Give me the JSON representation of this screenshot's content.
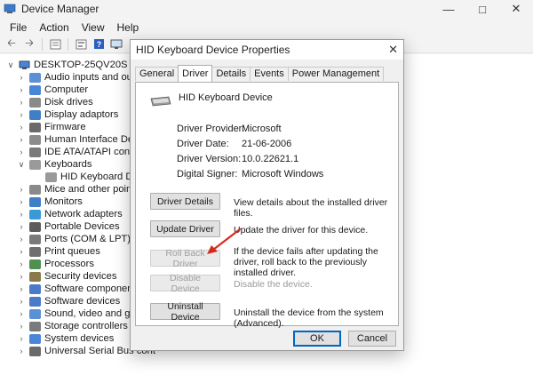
{
  "window": {
    "title": "Device Manager"
  },
  "menu": [
    "File",
    "Action",
    "View",
    "Help"
  ],
  "tree": {
    "root": "DESKTOP-25QV20S",
    "items": [
      {
        "label": "Audio inputs and outpu",
        "icon": "speaker-icon"
      },
      {
        "label": "Computer",
        "icon": "computer-icon"
      },
      {
        "label": "Disk drives",
        "icon": "disk-icon"
      },
      {
        "label": "Display adaptors",
        "icon": "display-icon"
      },
      {
        "label": "Firmware",
        "icon": "firmware-icon"
      },
      {
        "label": "Human Interface Device",
        "icon": "hid-icon"
      },
      {
        "label": "IDE ATA/ATAPI controlle",
        "icon": "ide-icon"
      },
      {
        "label": "Keyboards",
        "icon": "keyboard-icon",
        "expanded": true
      },
      {
        "label": "HID Keyboard Device",
        "icon": "keyboard-icon",
        "child": true
      },
      {
        "label": "Mice and other pointing",
        "icon": "mouse-icon"
      },
      {
        "label": "Monitors",
        "icon": "monitor-icon"
      },
      {
        "label": "Network adapters",
        "icon": "network-icon"
      },
      {
        "label": "Portable Devices",
        "icon": "portable-icon"
      },
      {
        "label": "Ports (COM & LPT)",
        "icon": "port-icon"
      },
      {
        "label": "Print queues",
        "icon": "printer-icon"
      },
      {
        "label": "Processors",
        "icon": "processor-icon"
      },
      {
        "label": "Security devices",
        "icon": "security-icon"
      },
      {
        "label": "Software components",
        "icon": "software-icon"
      },
      {
        "label": "Software devices",
        "icon": "software-icon"
      },
      {
        "label": "Sound, video and game",
        "icon": "sound-icon"
      },
      {
        "label": "Storage controllers",
        "icon": "storage-icon"
      },
      {
        "label": "System devices",
        "icon": "system-icon"
      },
      {
        "label": "Universal Serial Bus cont",
        "icon": "usb-icon"
      }
    ]
  },
  "dialog": {
    "title": "HID Keyboard Device Properties",
    "tabs": [
      "General",
      "Driver",
      "Details",
      "Events",
      "Power Management"
    ],
    "active_tab": "Driver",
    "device_name": "HID Keyboard Device",
    "props": [
      {
        "label": "Driver Provider:",
        "value": "Microsoft"
      },
      {
        "label": "Driver Date:",
        "value": "21-06-2006"
      },
      {
        "label": "Driver Version:",
        "value": "10.0.22621.1"
      },
      {
        "label": "Digital Signer:",
        "value": "Microsoft Windows"
      }
    ],
    "actions": [
      {
        "label": "Driver Details",
        "desc": "View details about the installed driver files.",
        "enabled": true
      },
      {
        "label": "Update Driver",
        "desc": "Update the driver for this device.",
        "enabled": true
      },
      {
        "label": "Roll Back Driver",
        "desc": "If the device fails after updating the driver, roll back to the previously installed driver.",
        "enabled": false
      },
      {
        "label": "Disable Device",
        "desc": "Disable the device.",
        "enabled": false
      },
      {
        "label": "Uninstall Device",
        "desc": "Uninstall the device from the system (Advanced).",
        "enabled": true
      }
    ],
    "ok_label": "OK",
    "cancel_label": "Cancel"
  },
  "colors": {
    "accent": "#0067c0",
    "annotation_arrow": "#d62a1e"
  }
}
